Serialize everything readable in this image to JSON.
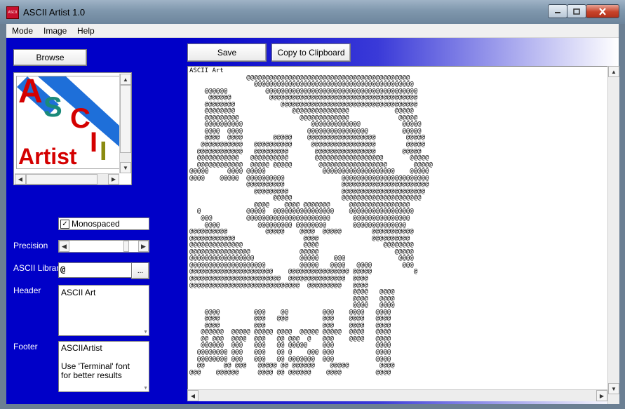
{
  "window": {
    "title": "ASCII Artist 1.0",
    "app_icon_text": "ASCII",
    "controls": {
      "minimize": "‒",
      "maximize": "☐",
      "close": "✕"
    }
  },
  "menu": {
    "items": [
      "Mode",
      "Image",
      "Help"
    ]
  },
  "left": {
    "browse_label": "Browse",
    "logo": {
      "line1": "A",
      "line2": "S",
      "line3": "C",
      "line4": "I",
      "line5": "I",
      "word": "Artist"
    },
    "monospaced": {
      "label": "Monospaced",
      "checked": true,
      "check_mark": "✓"
    },
    "precision": {
      "label": "Precision",
      "value": 0.85,
      "left_arrow": "◀",
      "right_arrow": "▶"
    },
    "ascii_library": {
      "label": "ASCII Library",
      "value": "@",
      "button": "..."
    },
    "header": {
      "label": "Header",
      "value": "ASCII Art"
    },
    "footer": {
      "label": "Footer",
      "value": "ASCIIArtist\n\nUse 'Terminal' font for better results"
    }
  },
  "toolbar": {
    "save_label": "Save",
    "copy_label": "Copy to Clipboard"
  },
  "output": {
    "text": "ASCII Art\n               @@@@@@@@@@@@@@@@@@@@@@@@@@@@@@@@@@@@@@@@@@@\n                 @@@@@@@@@@@@@@@@@@@@@@@@@@@@@@@@@@@@@@@@@@\n    @@@@@@          @@@@@@@@@@@@@@@@@@@@@@@@@@@@@@@@@@@@@@@@\n     @@@@@@          @@@@@@@@@@@@@@@@@@@@@@@@@@@@@@@@@@@@@@@\n    @@@@@@@@            @@@@@@@@@@@@@@@@@@@@@@@@@@@@@@@@@@@@\n    @@@@@@@@               @@@@@@@@@@@@@@@            @@@@@\n    @@@@@@@@@                @@@@@@@@@@@@@             @@@@@\n    @@@@@@@@@@                  @@@@@@@@@@@@@           @@@@@\n    @@@@  @@@@                 @@@@@@@@@@@@@@@@         @@@@@\n    @@@@  @@@@        @@@@@    @@@@@@@@@@@@@@@@@@        @@@@@\n   @@@@@@@@@@@   @@@@@@@@@@     @@@@@@@@@@@@@@@@@        @@@@@\n  @@@@@@@@@@@@   @@@@@@@@@       @@@@@@@@@@@@@@@@       @@@@@\n  @@@@@@@@@@@   @@@@@@@@@@       @@@@@@@@@@@@@@@@@@       @@@@@\n  @@@@@@@@@@@@  @@@@@ @@@@@       @@@@@@@@@@@@@@@@@@       @@@@@\n@@@@@     @@@@ @@@@@               @@@@@@@@@@@@@@@@@@@    @@@@@\n@@@@    @@@@@  @@@@@@@@@@               @@@@@@@@@@@@@@@@@@@@@@@\n               @@@@@@@@@@               @@@@@@@@@@@@@@@@@@@@@@@\n                 @@@@@@@@@              @@@@@@@@@@@@@@@@@@@@@@\n                      @@@@@             @@@@@@@@@@@@@@@@@@@@@\n                 @@@@    @@@@ @@@@@@@     @@@@@@@@@@@@@@@@\n  @            @@@@@  @@@@@@@@@@@@@@@@    @@@@@@@@@@@@@@@@@\n   @@@         @@@@@@@@@@@@@@@@@@@@@@      @@@@@@@@@@@@@@@\n    @@@@          @@@@@@@@@ @@@@@@@@       @@@@@@@@@@@@@@\n@@@@@@@@@@          @@@@@    @@@@  @@@@@        @@@@@@@@@@@\n@@@@@@@@@@@@                  @@@@              @@@@@@@@@@\n@@@@@@@@@@@@@@                @@@@                 @@@@@@@@\n@@@@@@@@@@@@@@@@             @@@@@                    @@@@@\n@@@@@@@@@@@@@@@@@            @@@@@    @@@              @@@@\n@@@@@@@@@@@@@@@@@@@@         @@@@@   @@@@   @@@@        @@@\n@@@@@@@@@@@@@@@@@@@@@@    @@@@@@@@@@@@@@@@ @@@@@           @\n@@@@@@@@@@@@@@@@@@@@@@@@  @@@@@@@@@@@@@@@  @@@@\n@@@@@@@@@@@@@@@@@@@@@@@@@@@@@  @@@@@@@@@   @@@@\n                                           @@@@   @@@@\n                                           @@@@   @@@@\n                                           @@@@   @@@@\n    @@@@         @@@    @@         @@@    @@@@   @@@@\n    @@@@         @@@   @@@         @@@    @@@@   @@@@\n    @@@@         @@@               @@@    @@@@   @@@@\n   @@@@@@  @@@@@ @@@@@ @@@@  @@@@@ @@@@@  @@@@   @@@@\n   @@ @@@  @@@@  @@@   @@ @@@  @   @@@    @@@@   @@@@\n   @@@@@@  @@@   @@@   @@ @@@@@    @@@           @@@@\n  @@@@@@@@ @@@   @@@   @@ @    @@@ @@@           @@@@\n  @@@@@@@@ @@@   @@@   @@ @@@@@@@  @@@           @@@@\n  @@     @@ @@@   @@@@@ @@ @@@@@@    @@@@@        @@@@\n@@@    @@@@@@     @@@@ @@ @@@@@@    @@@@         @@@@\n\n\n\n\nASCIIArtist\n\nUse 'Terminal' font for better results"
  },
  "colors": {
    "panel_blue": "#0000c8",
    "logo_red": "#d40000",
    "logo_teal": "#1a8a7a",
    "logo_olive": "#8a8a10",
    "logo_stripe": "#1e6fd9"
  }
}
